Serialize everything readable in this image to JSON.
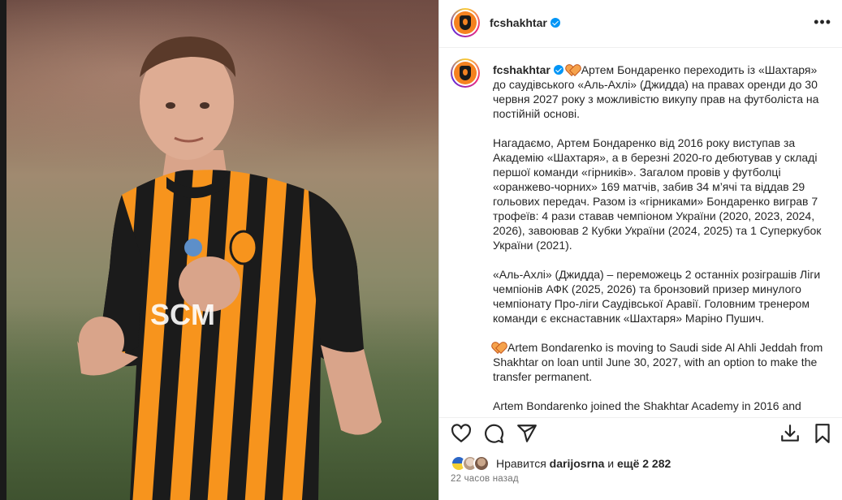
{
  "post": {
    "username": "fcshakhtar",
    "caption_paragraphs": [
      "Артем Бондаренко переходить із «Шахтаря» до саудівського «Аль-Ахлі» (Джидда) на правах оренди до 30 червня 2027 року з можливістю викупу прав на футболіста на постійній основі.",
      "Нагадаємо, Артем Бондаренко від 2016 року виступав за Академію «Шахтаря», а в березні 2020-го дебютував у складі першої команди «гірників». Загалом провів у футболці «оранжево-чорних» 169 матчів, забив 34 м’ячі та віддав 29 гольових передач. Разом із «гірниками» Бондаренко виграв 7 трофеїв: 4 рази ставав чемпіоном України (2020, 2023, 2024, 2026), завоював 2 Кубки України (2024, 2025) та 1 Суперкубок України (2021).",
      "«Аль-Ахлі» (Джидда) – переможець 2 останніх розіграшів Ліги чемпіонів АФК (2025, 2026) та бронзовий призер минулого чемпіонату Про-ліги Саудівської Аравії. Головним тренером команди є екснаставник «Шахтаря» Маріно Пушич.",
      "Artem Bondarenko is moving to Saudi side Al Ahli Jeddah from Shakhtar on loan until June 30, 2027, with an option to make the transfer permanent.",
      "Artem Bondarenko joined the Shakhtar Academy in 2016 and"
    ],
    "likes": {
      "prefix": "Нравится",
      "user": "darijosrna",
      "conjunction": "и",
      "rest": "ещё 2 282"
    },
    "timestamp": "22 часов назад"
  },
  "icons": {
    "more": "more-icon",
    "like": "heart-outline-icon",
    "comment": "comment-icon",
    "share": "send-icon",
    "download": "download-icon",
    "save": "bookmark-icon",
    "caption_emoji": "orange-heart-icon"
  },
  "colors": {
    "verified": "#0095f6",
    "brand_orange": "#f58220",
    "timestamp": "#737373"
  }
}
